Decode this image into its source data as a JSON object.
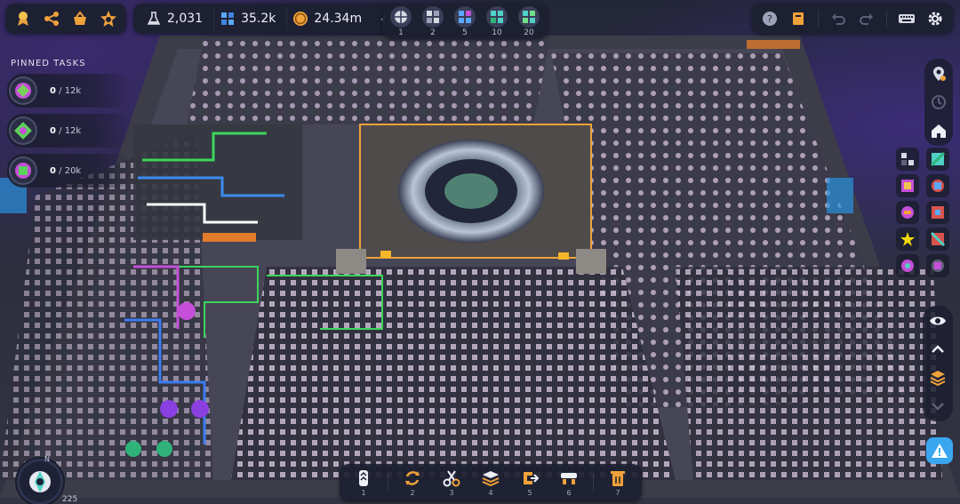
{
  "top_bar": {
    "quick_icons": [
      "achievements-icon",
      "share-icon",
      "shop-basket-icon",
      "star-badge-icon"
    ],
    "resources": [
      {
        "icon": "flask-icon",
        "value": "2,031",
        "color": "#d9d9e6"
      },
      {
        "icon": "blocks-icon",
        "value": "35.2k",
        "color": "#5aa8ff"
      },
      {
        "icon": "coin-icon",
        "value": "24.34m",
        "color": "#f0a23a"
      }
    ],
    "collapse_glyph": "‹",
    "layers": [
      {
        "number": "1"
      },
      {
        "number": "2"
      },
      {
        "number": "5"
      },
      {
        "number": "10"
      },
      {
        "number": "20"
      }
    ]
  },
  "top_right": {
    "tools": [
      "help-icon",
      "wiki-book-icon",
      "undo-icon",
      "redo-icon",
      "keyboard-icon",
      "settings-gear-icon"
    ]
  },
  "pinned": {
    "title": "PINNED TASKS",
    "tasks": [
      {
        "current": "0",
        "target": "/ 12k",
        "color": "#c64fd8"
      },
      {
        "current": "0",
        "target": "/ 12k",
        "color": "#5bd35b"
      },
      {
        "current": "0",
        "target": "/ 20k",
        "color": "#5bd35b"
      }
    ]
  },
  "toolbar": {
    "tools": [
      {
        "icon": "belt-icon",
        "number": "1"
      },
      {
        "icon": "rotator-icon",
        "number": "2"
      },
      {
        "icon": "cutter-icon",
        "number": "3"
      },
      {
        "icon": "stacker-icon",
        "number": "4"
      },
      {
        "icon": "painter-icon",
        "number": "5"
      },
      {
        "icon": "balancer-icon",
        "number": "6"
      },
      {
        "icon": "trash-icon",
        "number": "7"
      }
    ]
  },
  "compass": {
    "north": "N",
    "readout": "225"
  },
  "colors": {
    "accent_blue": "#3aa6f0",
    "accent_orange": "#f0a23a",
    "panel": "#1c1f30"
  }
}
